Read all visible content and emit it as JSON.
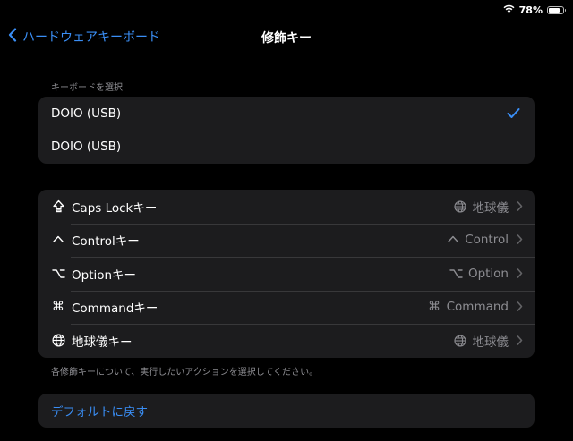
{
  "status_bar": {
    "battery_percent_label": "78%",
    "battery_level": 0.78,
    "wifi_icon": "wifi-icon"
  },
  "nav": {
    "back_label": "ハードウェアキーボード",
    "title": "修飾キー"
  },
  "keyboard_section": {
    "header": "キーボードを選択",
    "items": [
      {
        "label": "DOIO (USB)",
        "selected": true
      },
      {
        "label": "DOIO (USB)",
        "selected": false
      }
    ]
  },
  "modifiers": {
    "items": [
      {
        "icon": "caps-lock-icon",
        "label": "Caps Lockキー",
        "value_icon": "globe-icon",
        "value": "地球儀"
      },
      {
        "icon": "control-icon",
        "label": "Controlキー",
        "value_icon": "control-icon",
        "value": "Control"
      },
      {
        "icon": "option-icon",
        "label": "Optionキー",
        "value_icon": "option-icon",
        "value": "Option"
      },
      {
        "icon": "command-icon",
        "label": "Commandキー",
        "value_icon": "command-icon",
        "value": "Command"
      },
      {
        "icon": "globe-icon",
        "label": "地球儀キー",
        "value_icon": "globe-icon",
        "value": "地球儀"
      }
    ],
    "footer": "各修飾キーについて、実行したいアクションを選択してください。"
  },
  "reset": {
    "label": "デフォルトに戻す"
  },
  "colors": {
    "background": "#000000",
    "group_background": "#1c1c1e",
    "accent": "#3a8ef5",
    "secondary_text": "#8d8d92",
    "separator": "#38383a"
  }
}
